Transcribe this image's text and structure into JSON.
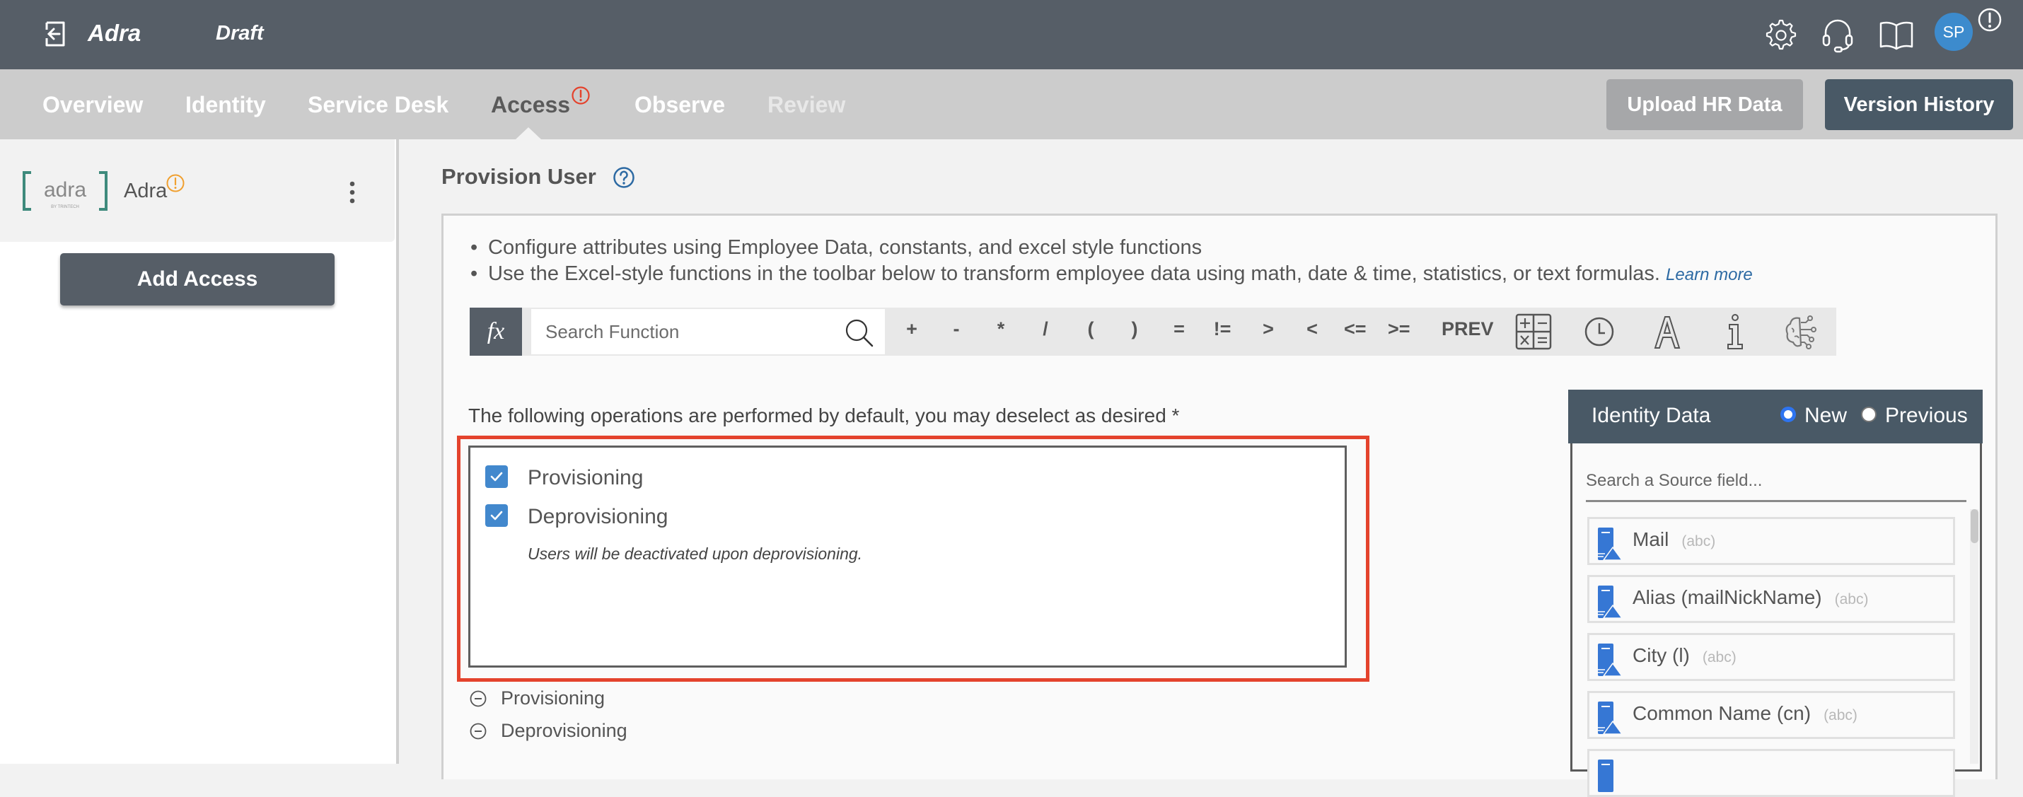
{
  "header": {
    "app_name": "Adra",
    "status": "Draft",
    "avatar_initials": "SP",
    "icons": [
      "back-icon",
      "gear-icon",
      "headset-icon",
      "book-icon",
      "alert-icon"
    ]
  },
  "nav": {
    "tabs": [
      {
        "label": "Overview",
        "state": "normal"
      },
      {
        "label": "Identity",
        "state": "normal"
      },
      {
        "label": "Service Desk",
        "state": "normal"
      },
      {
        "label": "Access",
        "state": "active",
        "alert": true
      },
      {
        "label": "Observe",
        "state": "normal"
      },
      {
        "label": "Review",
        "state": "disabled"
      }
    ],
    "upload_label": "Upload HR Data",
    "version_label": "Version History"
  },
  "sidebar": {
    "app_card": {
      "logo_text": "adra",
      "logo_sub": "BY TRINTECH",
      "name": "Adra",
      "warning": true
    },
    "add_access_label": "Add Access"
  },
  "main": {
    "title": "Provision User",
    "instructions": [
      "Configure attributes using Employee Data, constants, and excel style functions",
      "Use the Excel-style functions in the toolbar below to transform employee data using math, date & time, statistics, or text formulas."
    ],
    "learn_more": "Learn more",
    "toolbar": {
      "fx_label": "fx",
      "search_placeholder": "Search Function",
      "operators": [
        "+",
        "-",
        "*",
        "/",
        "(",
        ")",
        "=",
        "!=",
        ">",
        "<",
        "<=",
        ">=",
        "PREV"
      ],
      "icon_buttons": [
        "calculator-icon",
        "clock-icon",
        "text-icon",
        "info-icon",
        "ai-brain-icon"
      ]
    },
    "operations": {
      "label": "The following operations are performed by default, you may deselect as desired *",
      "items": [
        {
          "label": "Provisioning",
          "checked": true
        },
        {
          "label": "Deprovisioning",
          "checked": true
        }
      ],
      "note": "Users will be deactivated upon deprovisioning."
    },
    "collapsed_sections": [
      "Provisioning",
      "Deprovisioning"
    ]
  },
  "identity_data": {
    "title": "Identity Data",
    "options": [
      {
        "label": "New",
        "selected": true
      },
      {
        "label": "Previous",
        "selected": false
      }
    ],
    "search_placeholder": "Search a Source field...",
    "fields": [
      {
        "name": "Mail",
        "type": "(abc)"
      },
      {
        "name": "Alias (mailNickName)",
        "type": "(abc)"
      },
      {
        "name": "City (l)",
        "type": "(abc)"
      },
      {
        "name": "Common Name (cn)",
        "type": "(abc)"
      },
      {
        "name": "",
        "type": ""
      }
    ]
  },
  "colors": {
    "header_bg": "#565e67",
    "nav_bg": "#cccccc",
    "primary_button": "#495966",
    "accent_blue": "#4288cd",
    "highlight_red": "#e4432d",
    "warning_orange": "#f0a030"
  }
}
